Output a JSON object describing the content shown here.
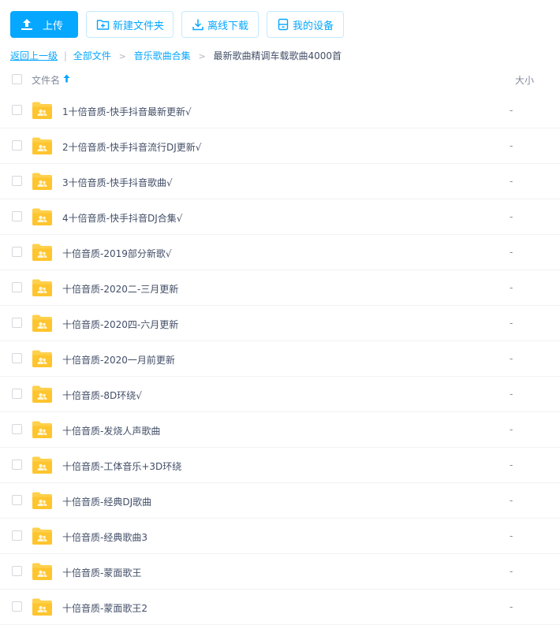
{
  "toolbar": {
    "upload_label": "上传",
    "new_folder_label": "新建文件夹",
    "offline_download_label": "离线下载",
    "my_devices_label": "我的设备"
  },
  "breadcrumb": {
    "back": "返回上一级",
    "separator": "|",
    "items": [
      "全部文件",
      "音乐歌曲合集"
    ],
    "arrow": ">",
    "current": "最新歌曲精调车载歌曲4000首"
  },
  "table": {
    "col_name": "文件名",
    "col_size": "大小"
  },
  "files": [
    {
      "name": "1十倍音质-快手抖音最新更新√",
      "size": "-"
    },
    {
      "name": "2十倍音质-快手抖音流行DJ更新√",
      "size": "-"
    },
    {
      "name": "3十倍音质-快手抖音歌曲√",
      "size": "-"
    },
    {
      "name": "4十倍音质-快手抖音DJ合集√",
      "size": "-"
    },
    {
      "name": "十倍音质-2019部分新歌√",
      "size": "-"
    },
    {
      "name": "十倍音质-2020二-三月更新",
      "size": "-"
    },
    {
      "name": "十倍音质-2020四-六月更新",
      "size": "-"
    },
    {
      "name": "十倍音质-2020一月前更新",
      "size": "-"
    },
    {
      "name": "十倍音质-8D环绕√",
      "size": "-"
    },
    {
      "name": "十倍音质-发烧人声歌曲",
      "size": "-"
    },
    {
      "name": "十倍音质-工体音乐+3D环绕",
      "size": "-"
    },
    {
      "name": "十倍音质-经典DJ歌曲",
      "size": "-"
    },
    {
      "name": "十倍音质-经典歌曲3",
      "size": "-"
    },
    {
      "name": "十倍音质-蒙面歌王",
      "size": "-"
    },
    {
      "name": "十倍音质-蒙面歌王2",
      "size": "-"
    }
  ],
  "icons": {
    "upload": "upload-icon",
    "new_folder": "folder-plus-icon",
    "download": "download-icon",
    "device": "device-icon",
    "sort": "sort-up-arrow-icon",
    "folder": "shared-folder-icon"
  },
  "colors": {
    "accent": "#06a7ff",
    "folder": "#ffd04b",
    "text": "#424e67",
    "muted": "#818999"
  }
}
